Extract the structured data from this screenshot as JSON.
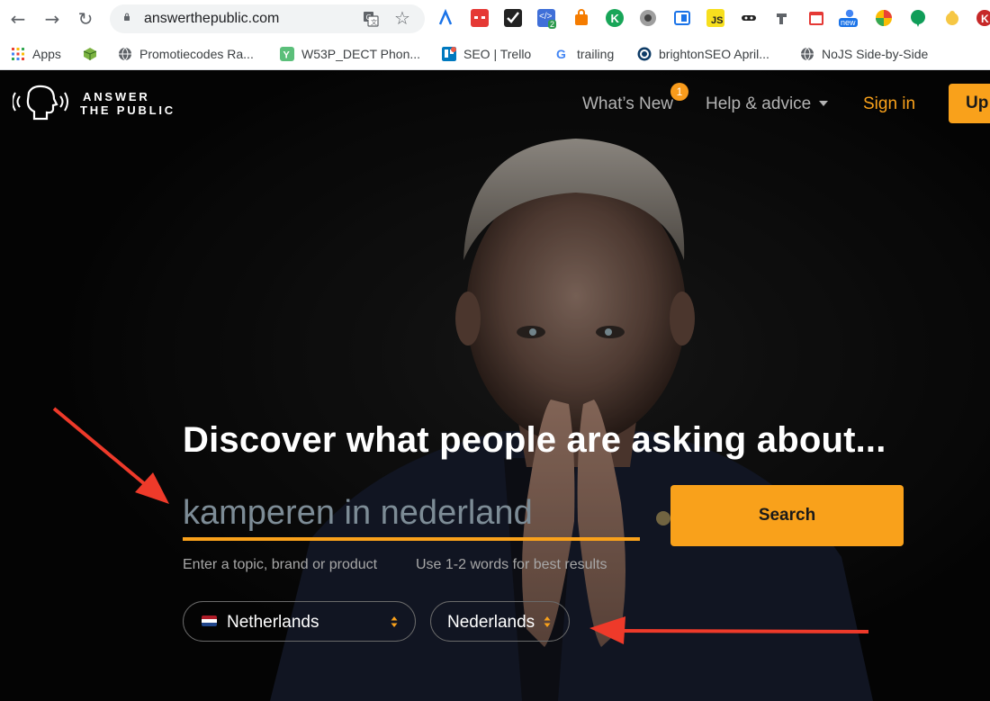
{
  "browser": {
    "url": "answerthepublic.com",
    "bookmarks": [
      {
        "label": "Apps",
        "icon": "apps-grid-icon"
      },
      {
        "label": "Promotiecodes Ra...",
        "icon": "globe-icon"
      },
      {
        "label": "W53P_DECT Phon...",
        "icon": "yoast-icon"
      },
      {
        "label": "SEO | Trello",
        "icon": "trello-icon"
      },
      {
        "label": "trailing",
        "icon": "google-icon"
      },
      {
        "label": "brightonSEO April...",
        "icon": "brightonseo-icon"
      },
      {
        "label": "NoJS Side-by-Side",
        "icon": "globe-icon"
      }
    ],
    "extension_badges": {
      "code_ext": "2",
      "new_ext": "new"
    }
  },
  "site": {
    "logo_line1": "ANSWER",
    "logo_line2": "THE PUBLIC",
    "nav": {
      "whats_new": "What’s New",
      "whats_new_count": "1",
      "help": "Help & advice",
      "signin": "Sign in",
      "upgrade": "Up"
    }
  },
  "hero": {
    "headline": "Discover what people are asking about...",
    "search_value": "kamperen in nederland",
    "search_button": "Search",
    "hint_left": "Enter a topic, brand or product",
    "hint_right": "Use 1-2 words for best results",
    "country": "Netherlands",
    "language": "Nederlands"
  },
  "colors": {
    "accent": "#f9a11b",
    "annotation_arrow": "#ee3a2a",
    "badge": "#f89b1c"
  }
}
